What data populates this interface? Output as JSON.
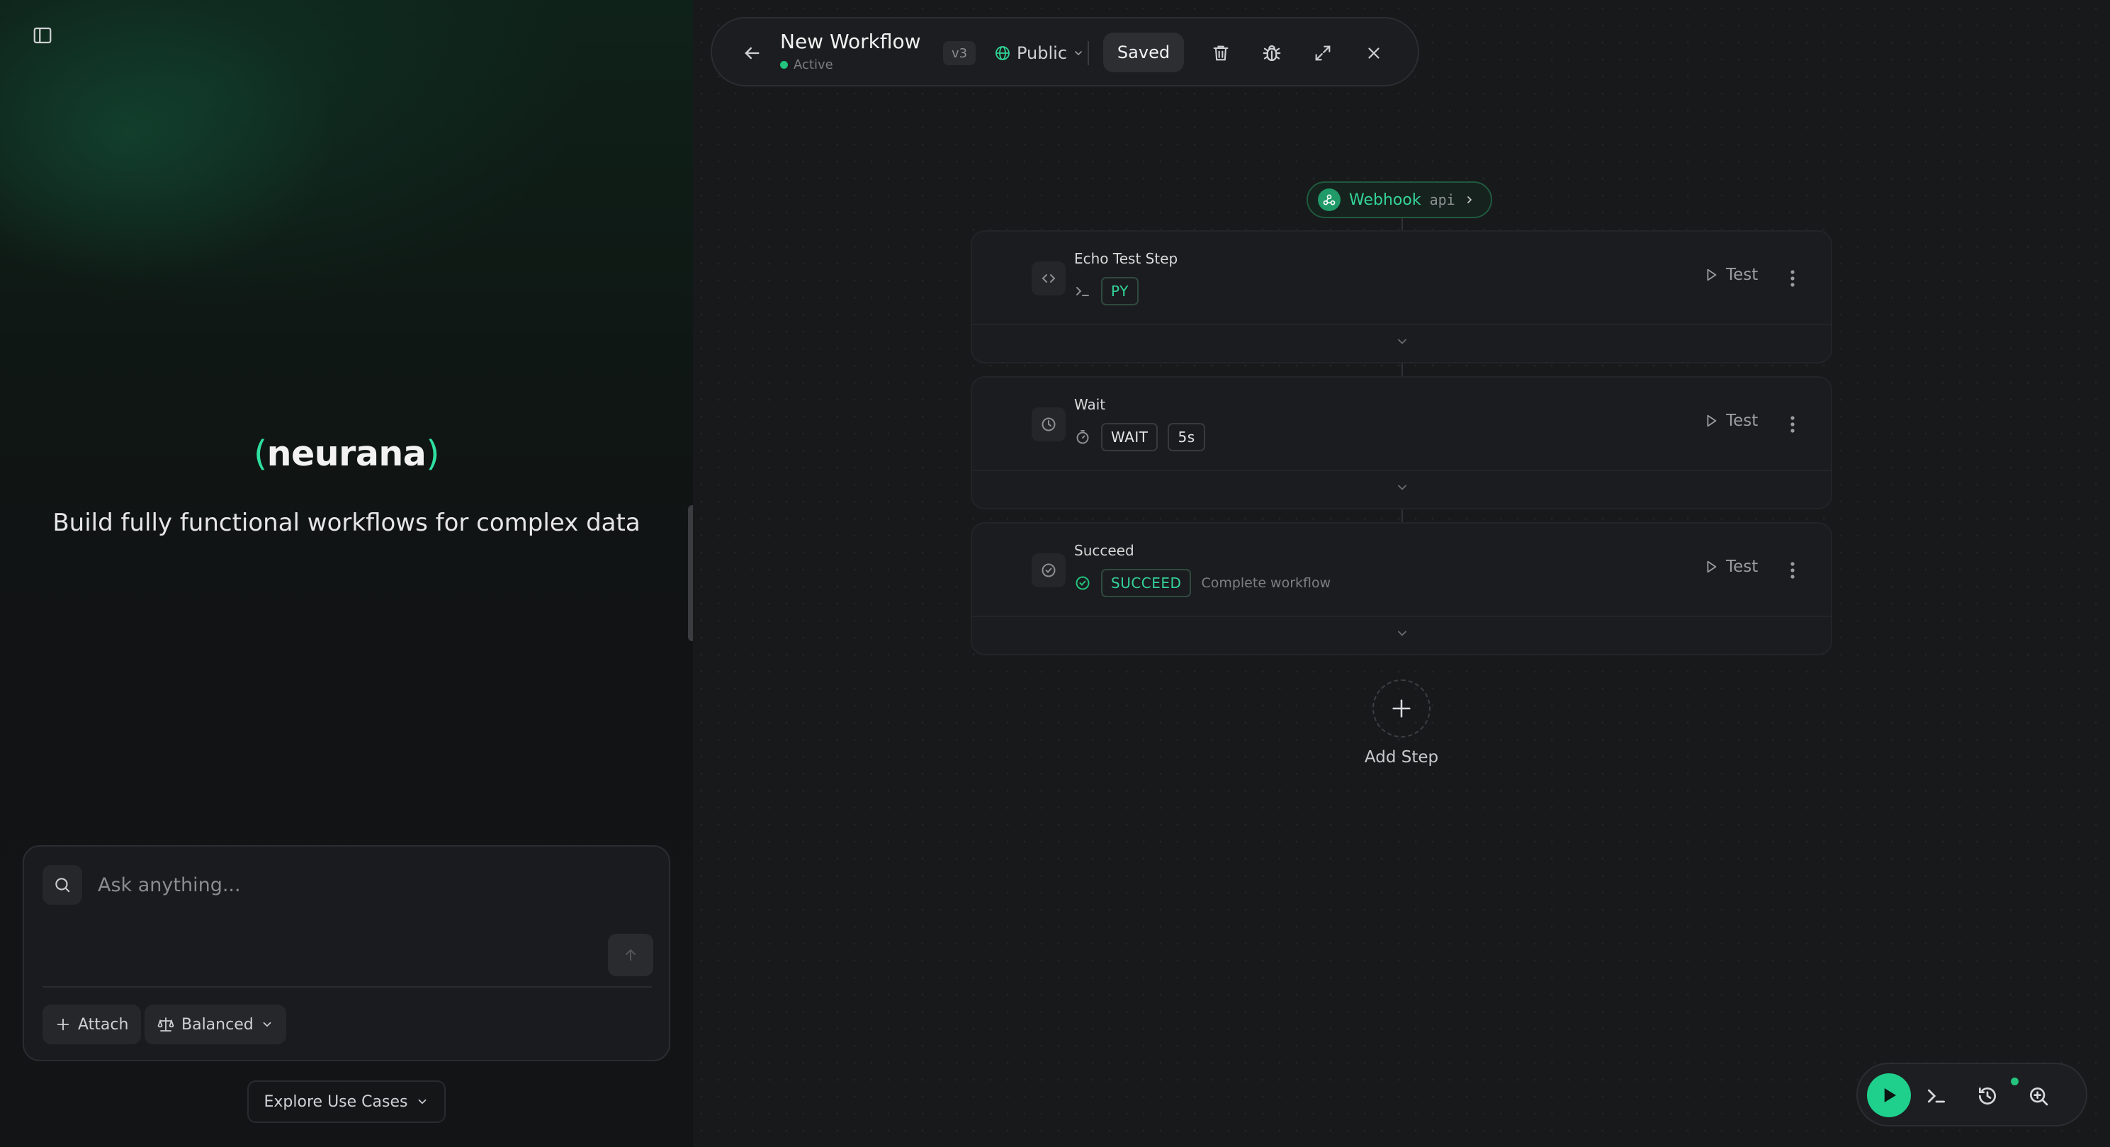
{
  "colors": {
    "accent": "#2fe0a0",
    "status_active": "#22c47e",
    "run_button": "#1fcf8c"
  },
  "hero": {
    "brand_open": "(",
    "brand_name": "neurana",
    "brand_close": ")",
    "tagline": "Build fully functional workflows for complex data"
  },
  "chat": {
    "placeholder": "Ask anything...",
    "attach_label": "Attach",
    "mode_label": "Balanced",
    "explore_label": "Explore Use Cases"
  },
  "header": {
    "title": "New Workflow",
    "status": "Active",
    "version": "v3",
    "visibility": "Public",
    "save_state": "Saved",
    "icons": [
      "back-arrow-icon",
      "globe-icon",
      "trash-icon",
      "bug-icon",
      "expand-icon",
      "close-icon"
    ]
  },
  "trigger": {
    "label": "Webhook",
    "type": "api"
  },
  "steps": [
    {
      "name": "Echo Test Step",
      "icon": "code-icon",
      "meta_icon": "terminal-icon",
      "badges": [
        "PY"
      ],
      "description": "",
      "test_label": "Test"
    },
    {
      "name": "Wait",
      "icon": "clock-icon",
      "meta_icon": "timer-icon",
      "badges": [
        "WAIT",
        "5s"
      ],
      "description": "",
      "test_label": "Test"
    },
    {
      "name": "Succeed",
      "icon": "check-circle-icon",
      "meta_icon": "check-circle-icon",
      "badges": [
        "SUCCEED"
      ],
      "description": "Complete workflow",
      "test_label": "Test"
    }
  ],
  "add_step": {
    "label": "Add Step"
  },
  "dock": {
    "icons": [
      "play-icon",
      "terminal-icon",
      "history-icon",
      "zoom-in-icon"
    ]
  }
}
